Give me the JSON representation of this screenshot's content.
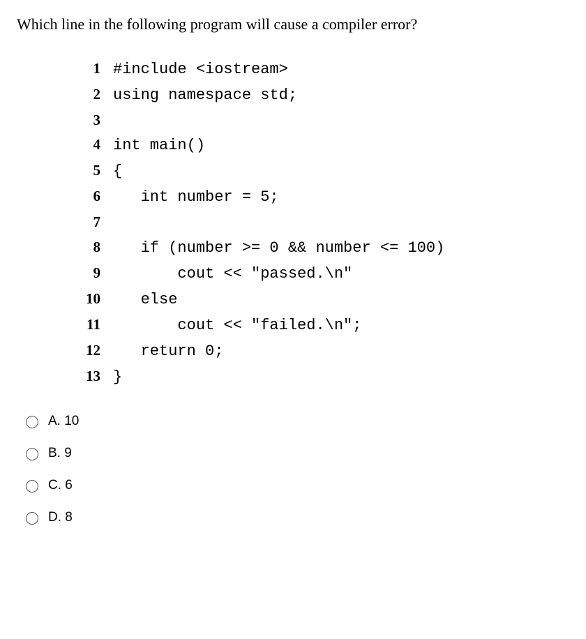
{
  "question": "Which line in the following program will cause a compiler error?",
  "code_lines": [
    {
      "n": "1",
      "t": "#include <iostream>"
    },
    {
      "n": "2",
      "t": "using namespace std;"
    },
    {
      "n": "3",
      "t": ""
    },
    {
      "n": "4",
      "t": "int main()"
    },
    {
      "n": "5",
      "t": "{"
    },
    {
      "n": "6",
      "t": "   int number = 5;"
    },
    {
      "n": "7",
      "t": ""
    },
    {
      "n": "8",
      "t": "   if (number >= 0 && number <= 100)"
    },
    {
      "n": "9",
      "t": "       cout << \"passed.\\n\""
    },
    {
      "n": "10",
      "t": "   else"
    },
    {
      "n": "11",
      "t": "       cout << \"failed.\\n\";"
    },
    {
      "n": "12",
      "t": "   return 0;"
    },
    {
      "n": "13",
      "t": "}"
    }
  ],
  "options": [
    {
      "label": "A. 10"
    },
    {
      "label": "B. 9"
    },
    {
      "label": "C. 6"
    },
    {
      "label": "D. 8"
    }
  ]
}
